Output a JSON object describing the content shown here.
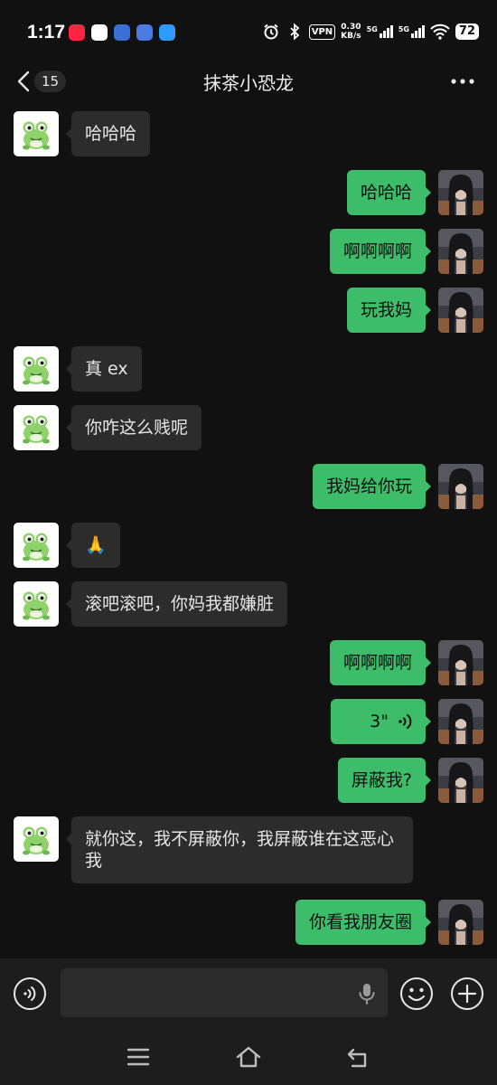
{
  "status_bar": {
    "time": "1:17",
    "vpn": "VPN",
    "speed_value": "0.30",
    "speed_unit": "KB/s",
    "signal_1": "5G",
    "signal_2": "5G",
    "battery": "72"
  },
  "header": {
    "unread_count": "15",
    "title": "抹茶小恐龙"
  },
  "messages": [
    {
      "side": "in",
      "text": "哈哈哈"
    },
    {
      "side": "out",
      "text": "哈哈哈"
    },
    {
      "side": "out",
      "text": "啊啊啊啊"
    },
    {
      "side": "out",
      "text": "玩我妈"
    },
    {
      "side": "in",
      "text": "真 ex"
    },
    {
      "side": "in",
      "text": "你咋这么贱呢"
    },
    {
      "side": "out",
      "text": "我妈给你玩"
    },
    {
      "side": "in",
      "text": "🙏"
    },
    {
      "side": "in",
      "text": "滚吧滚吧，你妈我都嫌脏"
    },
    {
      "side": "out",
      "text": "啊啊啊啊"
    },
    {
      "side": "out",
      "type": "voice",
      "text": "3\""
    },
    {
      "side": "out",
      "text": "屏蔽我?"
    },
    {
      "side": "in",
      "text": "就你这，我不屏蔽你，我屏蔽谁在这恶心我"
    },
    {
      "side": "out",
      "text": "你看我朋友圈"
    }
  ],
  "input_bar": {
    "placeholder": ""
  },
  "colors": {
    "background": "#111111",
    "outgoing_bubble": "#3dbc6a",
    "incoming_bubble": "#2c2c2c",
    "input_bar": "#1d1d1d"
  },
  "icons": {
    "back": "chevron-left-icon",
    "more": "more-dots-icon",
    "voice_mode": "voice-mode-icon",
    "mic": "mic-icon",
    "emoji": "emoji-icon",
    "add": "plus-icon",
    "nav_menu": "menu-icon",
    "nav_home": "home-icon",
    "nav_back": "back-icon",
    "incoming_avatar": "frog-avatar",
    "outgoing_avatar": "photo-avatar"
  }
}
